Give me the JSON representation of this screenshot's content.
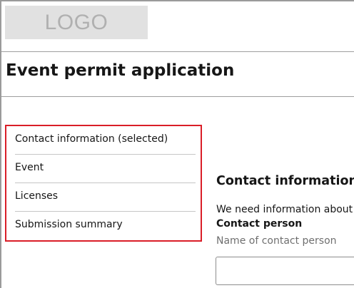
{
  "logo": {
    "text": "LOGO"
  },
  "page": {
    "title": "Event permit application"
  },
  "progress": {
    "steps": [
      {
        "label": "Contact information (selected)",
        "selected": true
      },
      {
        "label": "Event",
        "selected": false
      },
      {
        "label": "Licenses",
        "selected": false
      },
      {
        "label": "Submission summary",
        "selected": false
      }
    ]
  },
  "form": {
    "section_title": "Contact information",
    "intro": "We need information about",
    "contact_label": "Contact person",
    "contact_helper": "Name of contact person",
    "contact_value": ""
  },
  "colors": {
    "focus_border": "#da1e28",
    "divider": "#c6c6c6",
    "logo_bg": "#e1e1e1"
  }
}
